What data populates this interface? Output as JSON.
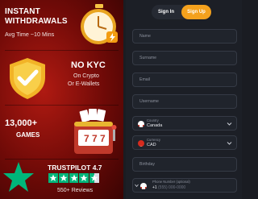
{
  "promo": {
    "block1": {
      "title_line1": "INSTANT",
      "title_line2": "WITHDRAWALS",
      "subtitle": "Avg Time ~10 Mins"
    },
    "block2": {
      "title": "NO KYC",
      "line1": "On Crypto",
      "line2": "Or E-Wallets"
    },
    "block3": {
      "title_line1": "13,000+",
      "title_line2": "GAMES"
    },
    "block4": {
      "title": "TRUSTPILOT 4.7",
      "reviews": "550+ Reviews"
    }
  },
  "auth": {
    "tabs": {
      "sign_in": "Sign In",
      "sign_up": "Sign Up"
    },
    "fields": {
      "name": "Name",
      "surname": "Surname",
      "email": "Email",
      "username": "Username",
      "country_label": "Country",
      "country_value": "Canada",
      "currency_label": "Currency",
      "currency_value": "CAD",
      "birthday": "Birthday",
      "phone_label": "Phone Number (optional)",
      "phone_code": "+1",
      "phone_placeholder": "(555) 000-0000"
    }
  },
  "colors": {
    "accent": "#f4a11d",
    "promo_red": "#8a0f0b",
    "panel": "#1c1f26",
    "trustpilot_green": "#00b67a"
  },
  "trustpilot": {
    "stars": 4.5,
    "max": 5
  }
}
